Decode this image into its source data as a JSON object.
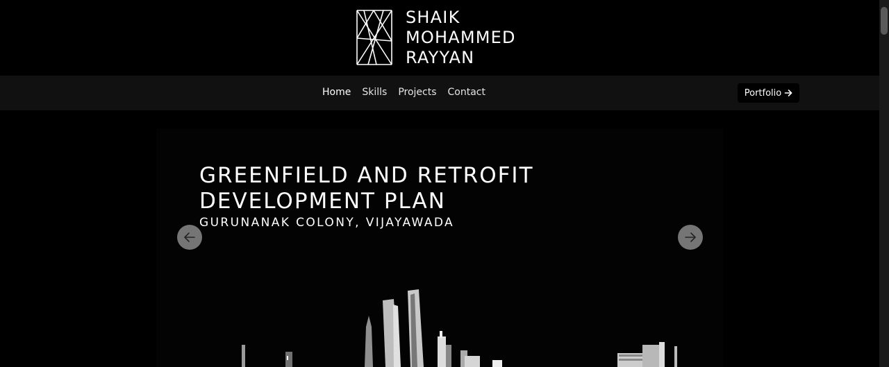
{
  "header": {
    "logo_lines": [
      "SHAIK",
      "MOHAMMED",
      "RAYYAN"
    ]
  },
  "nav": {
    "links": [
      "Home",
      "Skills",
      "Projects",
      "Contact"
    ],
    "portfolio_label": "Portfolio"
  },
  "hero": {
    "title_lines": [
      "GREENFIELD AND RETROFIT",
      "DEVELOPMENT PLAN"
    ],
    "subtitle": "GURUNANAK COLONY, VIJAYAWADA"
  },
  "icons": {
    "logo": "geometric-logo-icon",
    "portfolio_arrow": "arrow-right-icon",
    "prev": "arrow-left-icon",
    "next": "arrow-right-icon"
  },
  "colors": {
    "background": "#000000",
    "navbar": "#111111",
    "carousel_button": "#8a8a8a",
    "text": "#ffffff"
  }
}
